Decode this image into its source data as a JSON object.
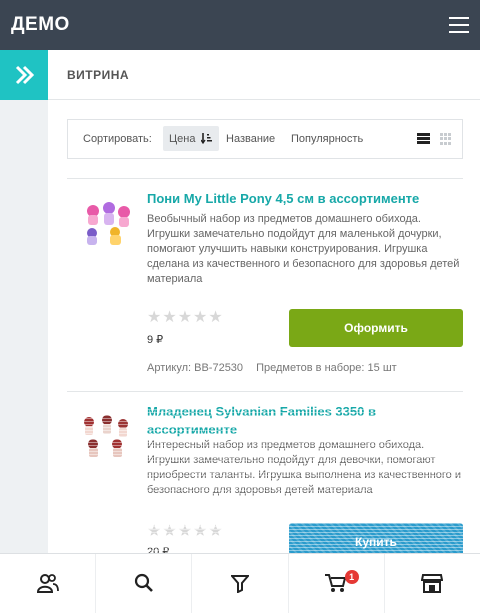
{
  "header": {
    "brand": "ДЕМО"
  },
  "breadcrumb": {
    "label": "ВИТРИНА"
  },
  "sort": {
    "label": "Сортировать:",
    "options": [
      {
        "label": "Цена",
        "active": true
      },
      {
        "label": "Название",
        "active": false
      },
      {
        "label": "Популярность",
        "active": false
      }
    ]
  },
  "products": [
    {
      "title": "Пони My Little Pony 4,5 см в ассортименте",
      "description": "Веобычный набор из предметов домашнего обихода. Игрушки замечательно подойдут для маленькой дочурки, помогают улучшить навыки конструирования. Игрушка сделана из качественного и безопасного для здоровья детей материала",
      "rating": 0,
      "price": "9 ₽",
      "button_label": "Оформить",
      "sku": "Артикул: BB-72530",
      "set_count": "Предметов в наборе: 15 шт"
    },
    {
      "title": "Младенец Sylvanian Families 3350 в ассортименте",
      "description": "Интересный набор из предметов домашнего обихода. Игрушки замечательно подойдут для девочки, помогают приобрести таланты. Игрушка выполнена из качественного и безопасного для здоровья детей материала",
      "rating": 0,
      "price": "20 ₽",
      "button_label": "Купить"
    }
  ],
  "tabbar": {
    "items": [
      "users-icon",
      "search-icon",
      "filter-icon",
      "cart-icon",
      "store-icon"
    ],
    "cart_count": "1"
  },
  "colors": {
    "topbar": "#3b4552",
    "accent_teal": "#1fc3c3",
    "title_teal": "#17a8a8",
    "order_green": "#7aa816",
    "buy_blue": "#2a9bcc",
    "badge_red": "#e53935"
  }
}
